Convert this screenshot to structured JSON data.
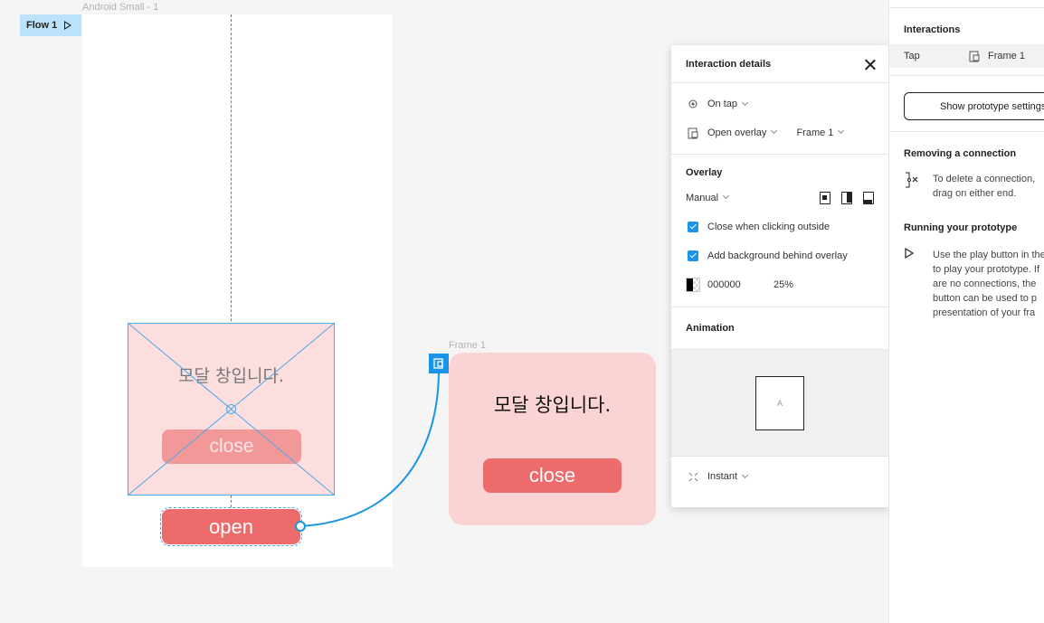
{
  "canvas": {
    "flow_label": "Flow 1",
    "phone_frame_label": "Android Small - 1",
    "frame1_label": "Frame 1",
    "modal_title": "모달 창입니다.",
    "modal_close_label": "close",
    "open_button_label": "open",
    "frame1_title": "모달 창입니다.",
    "frame1_close_label": "close"
  },
  "interaction_details": {
    "title": "Interaction details",
    "trigger": "On tap",
    "action": "Open overlay",
    "destination": "Frame 1",
    "overlay_section": "Overlay",
    "position": "Manual",
    "close_outside_label": "Close when clicking outside",
    "close_outside_checked": true,
    "add_background_label": "Add background behind overlay",
    "add_background_checked": true,
    "bg_color": "000000",
    "bg_opacity": "25%",
    "animation_section": "Animation",
    "preview_letter": "A",
    "transition": "Instant"
  },
  "right_panel": {
    "interactions_title": "Interactions",
    "interaction_trigger": "Tap",
    "interaction_target": "Frame 1",
    "show_settings_button": "Show prototype settings",
    "removing_title": "Removing a connection",
    "removing_text_1": "To delete a connection,",
    "removing_text_2": "drag on either end.",
    "running_title": "Running your prototype",
    "running_text_1": "Use the play button in the",
    "running_text_2": "to play your prototype. If",
    "running_text_3": "are no connections, the",
    "running_text_4": "button can be used to p",
    "running_text_5": "presentation of your fra"
  },
  "colors": {
    "accent": "#1a94e6",
    "button_red": "#ee6b6b",
    "modal_pink": "#fad4d4"
  }
}
